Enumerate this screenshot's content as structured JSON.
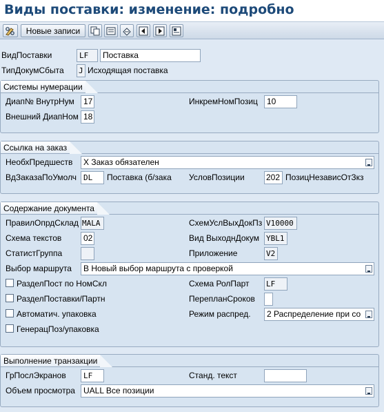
{
  "window": {
    "title": "Виды поставки: изменение: подробно"
  },
  "toolbar": {
    "new_entries_label": "Новые записи"
  },
  "header": {
    "delivery_type_label": "ВидПоставки",
    "delivery_type_value": "LF",
    "delivery_type_desc": "Поставка",
    "doc_cat_label": "ТипДокумСбыта",
    "doc_cat_value": "J",
    "doc_cat_desc": "Исходящая поставка"
  },
  "numbering": {
    "title": "Системы нумерации",
    "int_range_label": "Диап№ ВнутрНум",
    "int_range_value": "17",
    "increment_label": "ИнкремНомПозиц",
    "increment_value": "10",
    "ext_range_label": "Внешний ДиапНом",
    "ext_range_value": "18"
  },
  "order_ref": {
    "title": "Ссылка на заказ",
    "predecessor_label": "НеобхПредшеств",
    "predecessor_value": "X Заказ обязателен",
    "default_order_label": "ВдЗаказаПоУмолч",
    "default_order_value": "DL",
    "default_order_desc": "Поставка (б/зака",
    "item_req_label": "УсловПозиции",
    "item_req_value": "202",
    "item_req_desc": "ПозицНезависОтЗкз"
  },
  "doc_content": {
    "title": "Содержание документа",
    "storage_rule_label": "ПравилОпрдСклад",
    "storage_rule_value": "MALA",
    "output_proc_label": "СхемУслВыхДокПз",
    "output_proc_value": "V10000",
    "text_proc_label": "Схема текстов",
    "text_proc_value": "02",
    "output_type_label": "Вид ВыходнДокум",
    "output_type_value": "YBL1",
    "stat_group_label": "СтатистГруппа",
    "stat_group_value": "",
    "application_label": "Приложение",
    "application_value": "V2",
    "route_label": "Выбор маршрута",
    "route_value": "B Новый выбор маршрута с проверкой",
    "split_wh_label": "РазделПост по НомСкл",
    "partner_proc_label": "Схема РолПарт",
    "partner_proc_value": "LF",
    "split_partner_label": "РазделПоставки/Партн",
    "reschedule_label": "ПерепланСроков",
    "reschedule_value": "",
    "auto_pack_label": "Автоматич. упаковка",
    "distrib_label": "Режим распред.",
    "distrib_value": "2 Распределение при со",
    "gen_pack_label": "ГенерацПоз/упаковка"
  },
  "transaction": {
    "title": "Выполнение транзакции",
    "screen_seq_label": "ГрПослЭкранов",
    "screen_seq_value": "LF",
    "std_text_label": "Станд. текст",
    "std_text_value": "",
    "display_range_label": "Объем просмотра",
    "display_range_value": "UALL Все позиции"
  }
}
